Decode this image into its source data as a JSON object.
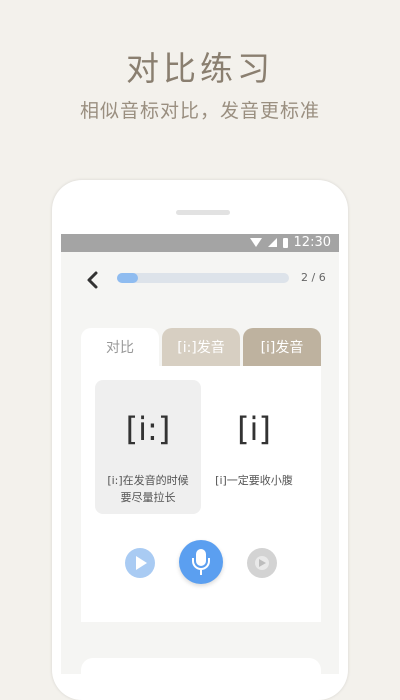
{
  "promo": {
    "headline": "对比练习",
    "subline": "相似音标对比，发音更标准"
  },
  "status_bar": {
    "time": "12:30",
    "icons": [
      "wifi-icon",
      "signal-icon",
      "battery-icon"
    ]
  },
  "top_bar": {
    "back_icon": "chevron-left-icon",
    "progress_fraction": 0.12,
    "counter": "2 / 6"
  },
  "tabs": [
    {
      "label": "对比",
      "active": true
    },
    {
      "label": "[i:]发音",
      "active": false
    },
    {
      "label": "[i]发音",
      "active": false
    }
  ],
  "comparison": [
    {
      "symbol": "[i:]",
      "description": "[i:]在发音的时候要尽量拉长"
    },
    {
      "symbol": "[i]",
      "description": "[i]一定要收小腹"
    }
  ],
  "controls": {
    "play_left_icon": "play-icon",
    "record_icon": "microphone-icon",
    "play_right_icon": "play-icon"
  },
  "colors": {
    "background": "#f3f1ec",
    "accent_blue": "#5b9ff0",
    "tab_light": "#d7cfc2",
    "tab_dark": "#beb29f",
    "headline": "#8a7f70"
  }
}
